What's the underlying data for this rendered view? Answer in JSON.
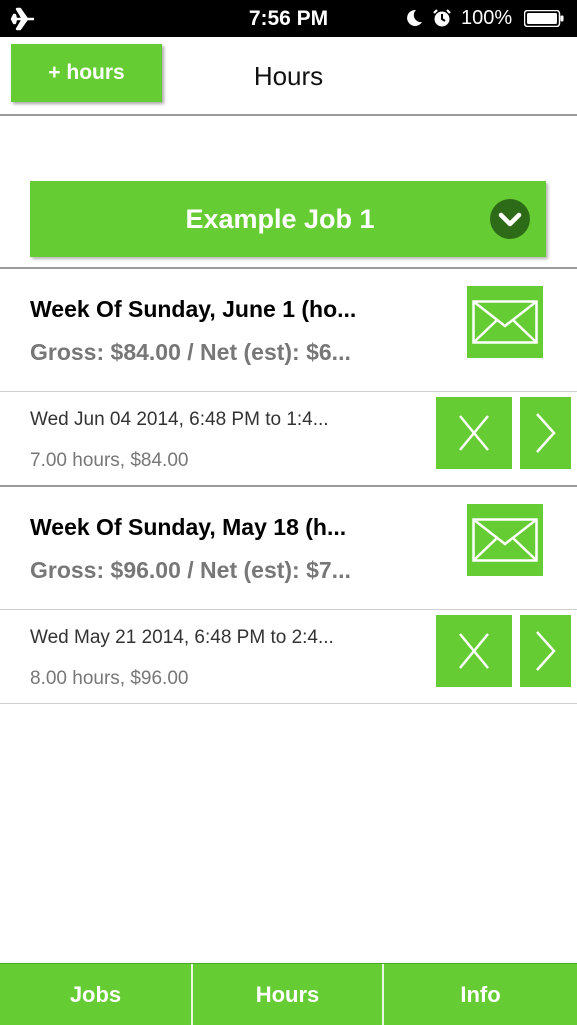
{
  "status_bar": {
    "time": "7:56 PM",
    "battery_text": "100%",
    "icons": [
      "airplane-icon",
      "moon-icon",
      "alarm-icon",
      "battery-icon"
    ]
  },
  "nav": {
    "add_button_label": "+ hours",
    "title": "Hours"
  },
  "job_selector": {
    "label": "Example Job 1",
    "icon": "chevron-down-icon"
  },
  "weeks": [
    {
      "title": "Week Of Sunday, June 1 (ho...",
      "summary": "Gross: $84.00 / Net (est): $6...",
      "entries": [
        {
          "title": "Wed Jun 04 2014, 6:48 PM to 1:4...",
          "detail": "7.00 hours, $84.00"
        }
      ]
    },
    {
      "title": "Week Of Sunday, May 18 (h...",
      "summary": "Gross: $96.00 / Net (est): $7...",
      "entries": [
        {
          "title": "Wed May 21 2014, 6:48 PM to 2:4...",
          "detail": "8.00 hours, $96.00"
        }
      ]
    }
  ],
  "tabs": [
    {
      "label": "Jobs"
    },
    {
      "label": "Hours"
    },
    {
      "label": "Info"
    }
  ],
  "colors": {
    "accent": "#66cc33",
    "status_bar": "#000000",
    "subtext": "#777777"
  }
}
